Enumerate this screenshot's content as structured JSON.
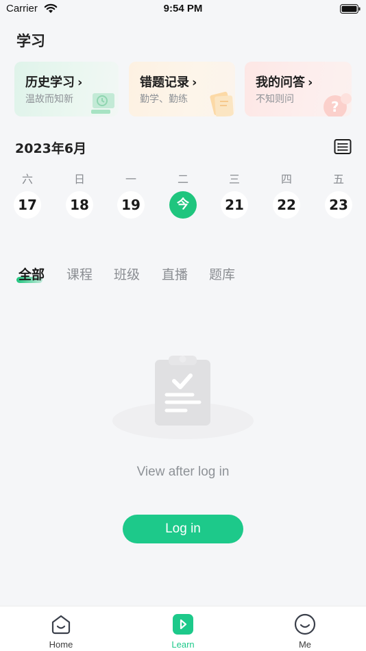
{
  "status_bar": {
    "carrier": "Carrier",
    "time": "9:54 PM"
  },
  "page": {
    "title": "学习"
  },
  "cards": [
    {
      "title": "历史学习",
      "subtitle": "温故而知新",
      "icon": "clock-icon"
    },
    {
      "title": "错题记录",
      "subtitle": "勤学、勤练",
      "icon": "notebook-icon"
    },
    {
      "title": "我的问答",
      "subtitle": "不知则问",
      "icon": "question-icon"
    }
  ],
  "card_arrow": "›",
  "calendar": {
    "month": "2023年6月",
    "weekdays": [
      "六",
      "日",
      "一",
      "二",
      "三",
      "四",
      "五"
    ],
    "days": [
      "17",
      "18",
      "19",
      "今",
      "21",
      "22",
      "23"
    ],
    "today_index": 3,
    "accent": "#1fc57e"
  },
  "tabs": [
    "全部",
    "课程",
    "班级",
    "直播",
    "题库"
  ],
  "active_tab": 0,
  "empty_state": {
    "text": "View after log in",
    "icon": "clipboard-check-icon"
  },
  "login_button": "Log in",
  "nav": [
    {
      "label": "Home",
      "icon": "home-icon"
    },
    {
      "label": "Learn",
      "icon": "learn-play-icon"
    },
    {
      "label": "Me",
      "icon": "me-smile-icon"
    }
  ],
  "active_nav": 1,
  "colors": {
    "primary": "#1dc98a",
    "background": "#f5f6f8"
  }
}
